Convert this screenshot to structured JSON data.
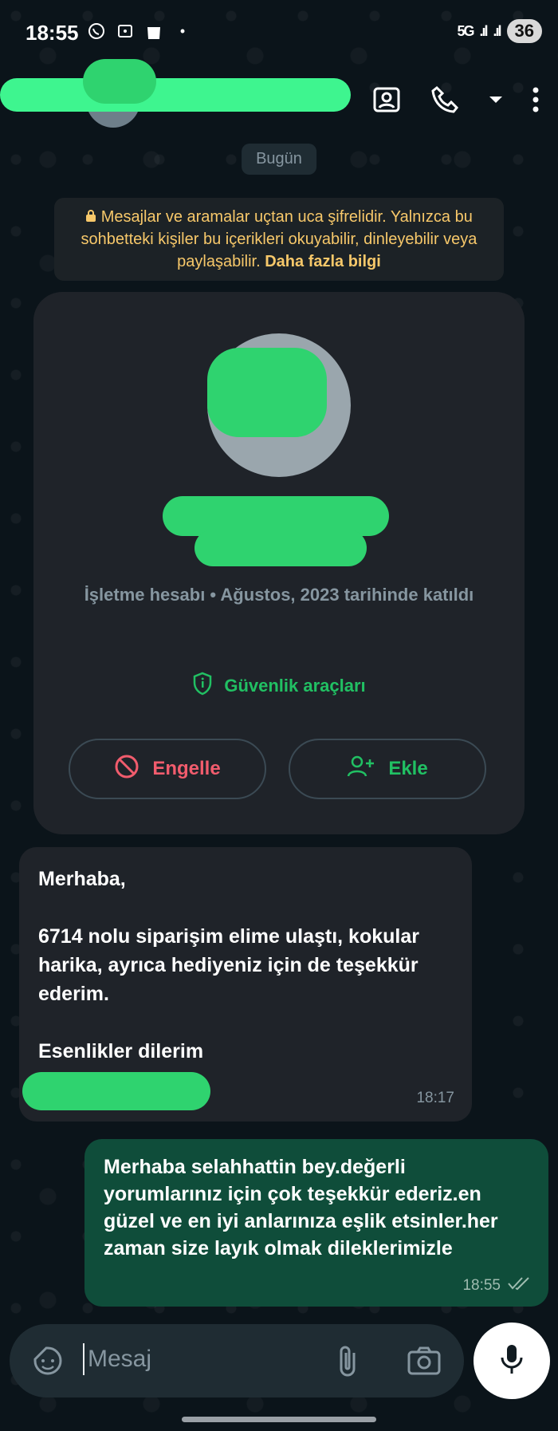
{
  "status_bar": {
    "time": "18:55",
    "network": "5G",
    "battery": "36",
    "icons": [
      "whatsapp-icon",
      "screenshot-icon",
      "shop-icon",
      "dot-icon"
    ]
  },
  "app_bar": {
    "actions": [
      "contact-card-icon",
      "call-icon",
      "chevron-down-icon",
      "more-icon"
    ]
  },
  "chat": {
    "date_chip": "Bugün",
    "encryption_notice": {
      "text": "Mesajlar ve aramalar uçtan uca şifrelidir. Yalnızca bu sohbetteki kişiler bu içerikleri okuyabilir, dinleyebilir veya paylaşabilir.",
      "link": "Daha fazla bilgi"
    },
    "profile_card": {
      "meta": "İşletme hesabı • Ağustos, 2023 tarihinde katıldı",
      "safety_tools": "Güvenlik araçları",
      "block_label": "Engelle",
      "add_label": "Ekle"
    },
    "messages": [
      {
        "direction": "incoming",
        "text": "Merhaba,\n\n6714 nolu siparişim elime ulaştı, kokular harika, ayrıca hediyeniz için de teşekkür ederim.\n\nEsenlikler dilerim",
        "time": "18:17"
      },
      {
        "direction": "outgoing",
        "text": "Merhaba selahhattin bey.değerli yorumlarınız için çok teşekkür ederiz.en güzel ve en iyi anlarınıza eşlik etsinler.her zaman size layık olmak dileklerimizle",
        "time": "18:55",
        "status": "read"
      }
    ]
  },
  "composer": {
    "placeholder": "Mesaj"
  },
  "colors": {
    "background": "#0b141a",
    "accent_green": "#21c063",
    "danger_red": "#f15c6d",
    "outgoing_bubble": "#0f4d3a",
    "incoming_bubble": "#1f2329",
    "notice_yellow": "#f7c86a"
  }
}
